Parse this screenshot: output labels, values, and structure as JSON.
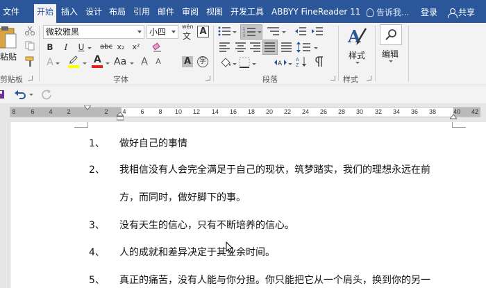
{
  "tabs": [
    {
      "label": "文件",
      "active": false
    },
    {
      "label": "开始",
      "active": true
    },
    {
      "label": "插入",
      "active": false
    },
    {
      "label": "设计",
      "active": false
    },
    {
      "label": "布局",
      "active": false
    },
    {
      "label": "引用",
      "active": false
    },
    {
      "label": "邮件",
      "active": false
    },
    {
      "label": "审阅",
      "active": false
    },
    {
      "label": "视图",
      "active": false
    },
    {
      "label": "开发工具",
      "active": false
    },
    {
      "label": "ABBYY FineReader 11",
      "active": false
    }
  ],
  "tell_me": "告诉我...",
  "login": "登录",
  "share": "共享",
  "ribbon": {
    "clipboard": {
      "paste_label": "粘贴",
      "group_label": "剪贴板"
    },
    "font": {
      "font_name": "微软雅黑",
      "font_size": "小四",
      "pinyin_icon_text": "wén",
      "char_border_text": "A",
      "bold": "B",
      "italic": "I",
      "underline": "U",
      "strike": "abc",
      "subscript": "x₂",
      "superscript": "x²",
      "group_label": "字体",
      "char_shading": "A",
      "enclose": "字"
    },
    "paragraph": {
      "group_label": "段落"
    },
    "styles": {
      "label": "样式",
      "group_label": "样式"
    },
    "editing": {
      "label": "编辑"
    }
  },
  "ruler": {
    "labels": [
      "8",
      "6",
      "4",
      "2",
      "2",
      "4",
      "6",
      "8",
      "10",
      "12",
      "14",
      "16",
      "18",
      "20",
      "22",
      "24",
      "26",
      "28",
      "30",
      "32",
      "34",
      "36",
      "38",
      "40",
      "42"
    ]
  },
  "document": {
    "items": [
      {
        "num": "1、",
        "text": "做好自己的事情"
      },
      {
        "num": "2、",
        "text": "我相信没有人会完全满足于自己的现状，筑梦踏实，我们的理想永远在前"
      },
      {
        "num": "",
        "text": "方，而同时，做好脚下的事。"
      },
      {
        "num": "3、",
        "text": "没有天生的信心，只有不断培养的信心。"
      },
      {
        "num": "4、",
        "text": "人的成就和差异决定于其业余时间。"
      },
      {
        "num": "5、",
        "text": "真正的痛苦，没有人能与你分担。你只能把它从一个肩头，换到你的另一"
      }
    ]
  },
  "colors": {
    "title_bar": "#2b579a",
    "ribbon_bg": "#f3f3f3",
    "font_color_red": "#e02020",
    "highlight_yellow": "#ffff00"
  }
}
